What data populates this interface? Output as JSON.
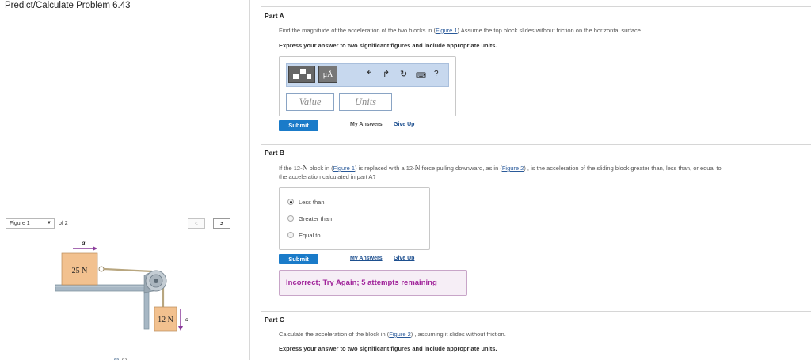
{
  "page": {
    "problem_title": "Predict/Calculate Problem 6.43"
  },
  "figure_panel": {
    "select_value": "Figure 1",
    "of_label": "of 2",
    "prev_label": "<",
    "next_label": ">",
    "accel_label_top": "a",
    "block_top_label": "25 N",
    "block_hanging_label": "12 N",
    "accel_label_side": "a",
    "active_page": 1,
    "page_count": 2
  },
  "part_a": {
    "title": "Part A",
    "question_pre": "Find the magnitude of the acceleration of the two blocks in (",
    "question_link": "Figure 1",
    "question_post": ")  Assume the top block slides without friction on the horizontal surface.",
    "instruction": "Express your answer to two significant figures and include appropriate units.",
    "toolbar_mu_label": "μÅ",
    "toolbar_icons": [
      "templates-icon",
      "units-icon",
      "undo-icon",
      "redo-icon",
      "reset-icon",
      "keyboard-icon",
      "help-icon"
    ],
    "help_label": "?",
    "value_placeholder": "Value",
    "units_placeholder": "Units",
    "submit_label": "Submit",
    "my_answers_label": "My Answers",
    "give_up_label": "Give Up"
  },
  "part_b": {
    "title": "Part B",
    "question_p1": "If the 12-",
    "question_n1": "N",
    "question_p2": " block in (",
    "question_link1": "Figure 1",
    "question_p3": ") is replaced with a 12-",
    "question_n2": "N",
    "question_p4": " force pulling downward, as in (",
    "question_link2": "Figure 2",
    "question_p5": ") , is the acceleration of the sliding block greater than, less than, or equal to",
    "question_line2": "the acceleration calculated in part A?",
    "choices": [
      {
        "label": "Less than",
        "selected": true
      },
      {
        "label": "Greater than",
        "selected": false
      },
      {
        "label": "Equal to",
        "selected": false
      }
    ],
    "submit_label": "Submit",
    "my_answers_label": "My Answers",
    "give_up_label": "Give Up",
    "feedback": "Incorrect; Try Again; 5 attempts remaining"
  },
  "part_c": {
    "title": "Part C",
    "question_pre": "Calculate the acceleration of the block in (",
    "question_link": "Figure 2",
    "question_post": ") , assuming it slides without friction.",
    "instruction": "Express your answer to two significant figures and include appropriate units."
  },
  "colors": {
    "submit_blue": "#1a7bc9",
    "toolbar_bg": "#c7d8ee",
    "feedback_text": "#a0239a",
    "feedback_bg": "#f6eef6",
    "block_fill": "#f2c18f",
    "accel_arrow": "#8a3b9a"
  }
}
